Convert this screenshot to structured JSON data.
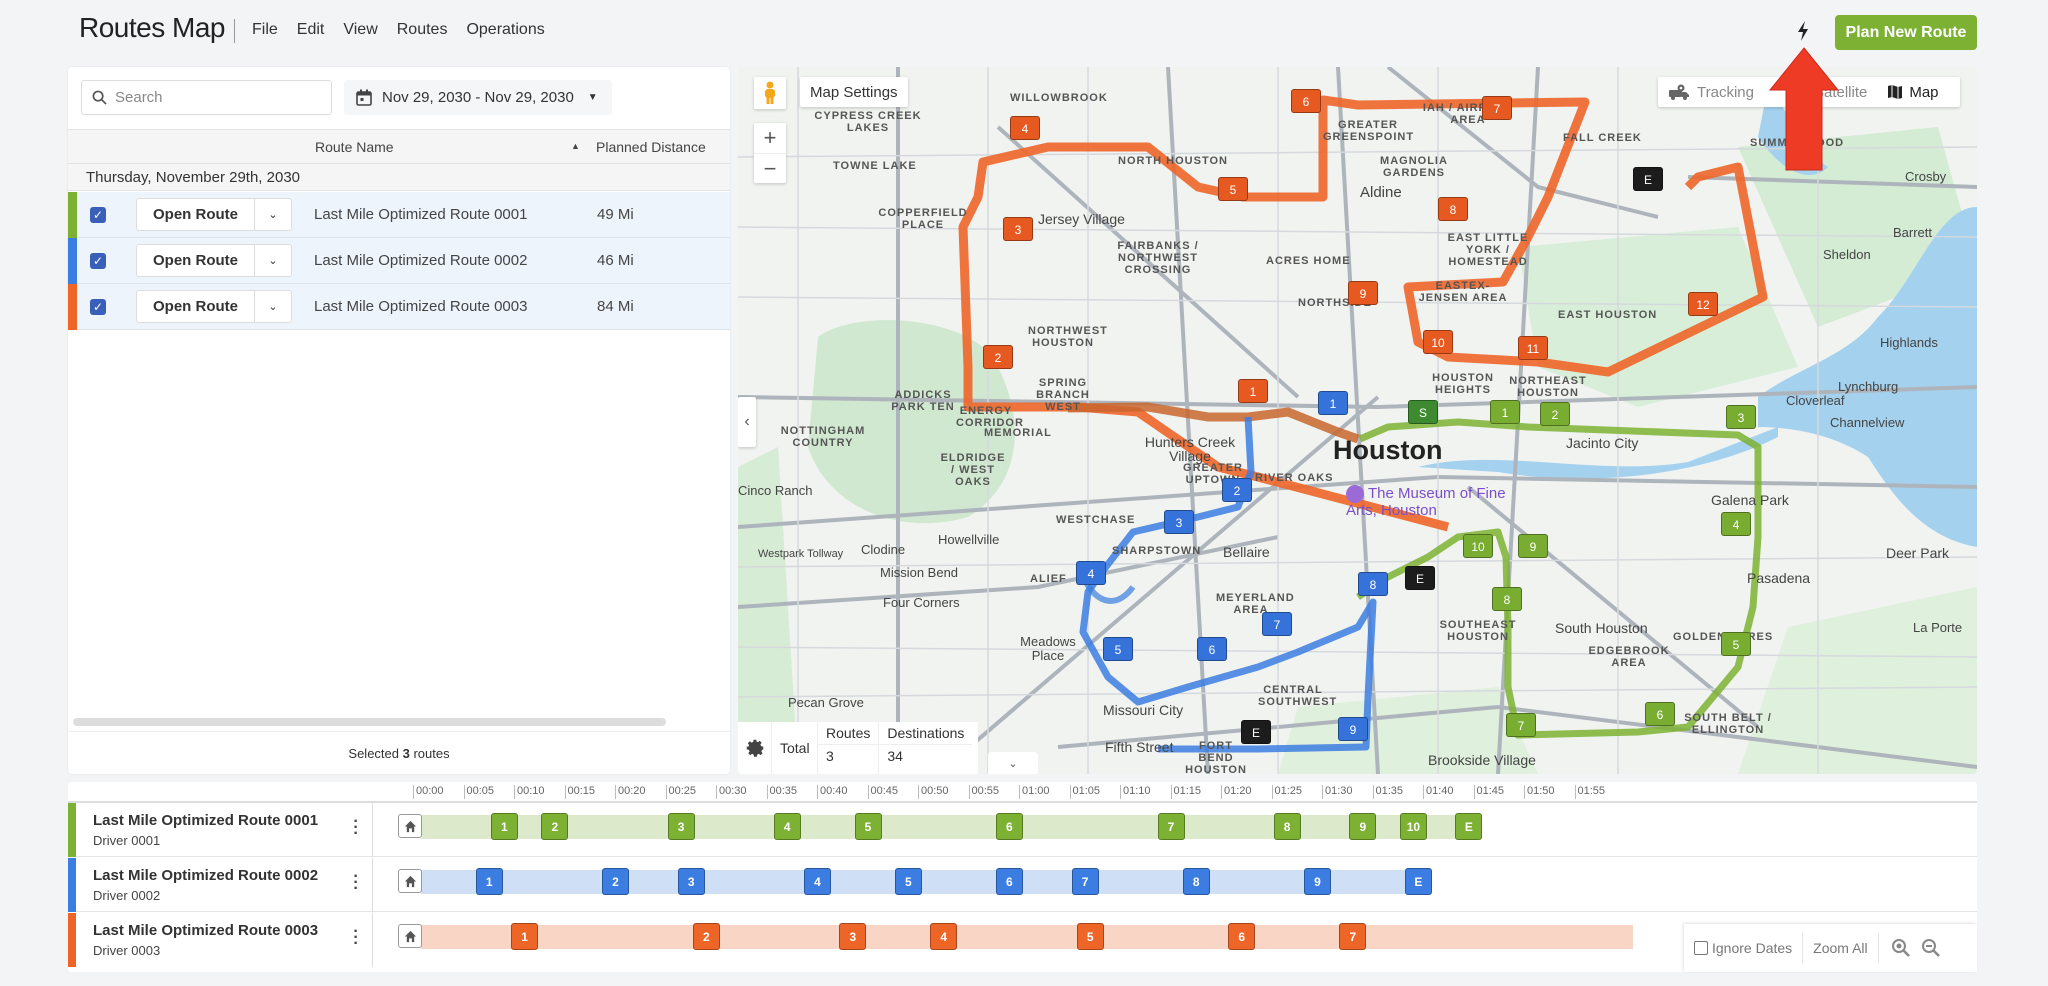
{
  "header": {
    "title": "Routes Map",
    "menu": [
      "File",
      "Edit",
      "View",
      "Routes",
      "Operations"
    ],
    "plan_new_route_label": "Plan New Route"
  },
  "left_panel": {
    "search_placeholder": "Search",
    "date_range": "Nov 29, 2030 - Nov 29, 2030",
    "columns": {
      "route_name": "Route Name",
      "planned_distance": "Planned Distance"
    },
    "group_label": "Thursday, November 29th, 2030",
    "open_route_label": "Open Route",
    "routes": [
      {
        "name": "Last Mile Optimized Route 0001",
        "distance": "49 Mi",
        "color": "#7cb133",
        "checked": true
      },
      {
        "name": "Last Mile Optimized Route 0002",
        "distance": "46 Mi",
        "color": "#3b7de0",
        "checked": true
      },
      {
        "name": "Last Mile Optimized Route 0003",
        "distance": "84 Mi",
        "color": "#ee6528",
        "checked": true
      }
    ],
    "footer": {
      "prefix": "Selected ",
      "count": "3",
      "suffix": " routes"
    }
  },
  "map": {
    "map_settings_label": "Map Settings",
    "tracking_label": "Tracking",
    "satellite_label": "Satellite",
    "map_label": "Map",
    "city_label": "Houston",
    "poi_label": "The Museum of Fine Arts, Houston",
    "totals": {
      "label": "Total",
      "routes_header": "Routes",
      "destinations_header": "Destinations",
      "routes_value": "3",
      "destinations_value": "34"
    },
    "place_labels": [
      "WILLOWBROOK",
      "CYPRESS CREEK LAKES",
      "TOWNE LAKE",
      "NORTH HOUSTON",
      "GREATER GREENSPOINT",
      "IAH / AIRPORT AREA",
      "FALL CREEK",
      "SUMMERWOOD",
      "MAGNOLIA GARDENS",
      "Aldine",
      "Jersey Village",
      "COPPERFIELD PLACE",
      "ACRES HOME",
      "EAST LITTLE YORK / HOMESTEAD",
      "FAIRBANKS / NORTHWEST CROSSING",
      "NORTHSIDE",
      "EASTEX-JENSEN AREA",
      "Sheldon",
      "Barrett",
      "Crosby",
      "EAST HOUSTON",
      "Highlands",
      "NORTHWEST HOUSTON",
      "SPRING BRANCH WEST",
      "ADDICKS PARK TEN",
      "ENERGY CORRIDOR",
      "NOTTINGHAM COUNTRY",
      "MEMORIAL",
      "HOUSTON HEIGHTS",
      "NORTHEAST HOUSTON",
      "Lynchburg",
      "Cloverleaf",
      "Channelview",
      "ELDRIDGE / WEST OAKS",
      "Hunters Creek Village",
      "GREATER UPTOWN",
      "RIVER OAKS",
      "Jacinto City",
      "Cinco Ranch",
      "Galena Park",
      "WESTCHASE",
      "Howellville",
      "Westpark Tollway",
      "Clodine",
      "SHARPSTOWN",
      "Bellaire",
      "Deer Park",
      "Mission Bend",
      "ALIEF",
      "Pasadena",
      "Four Corners",
      "MEYERLAND AREA",
      "SOUTHEAST HOUSTON",
      "South Houston",
      "Meadows Place",
      "GOLDEN ACRES",
      "La Porte",
      "EDGEBROOK AREA",
      "CENTRAL SOUTHWEST",
      "Missouri City",
      "SOUTH BELT / ELLINGTON",
      "Fifth Street",
      "FORT BEND HOUSTON",
      "Brookside Village",
      "Pecan Grove"
    ],
    "markers": {
      "route_0001": [
        "S",
        "1",
        "2",
        "3",
        "4",
        "5",
        "6",
        "7",
        "8",
        "9",
        "10",
        "E"
      ],
      "route_0002": [
        "1",
        "2",
        "3",
        "4",
        "5",
        "6",
        "7",
        "8",
        "9",
        "E"
      ],
      "route_0003": [
        "1",
        "2",
        "3",
        "4",
        "5",
        "6",
        "7",
        "8",
        "9",
        "10",
        "11",
        "12",
        "E"
      ]
    }
  },
  "timeline": {
    "ticks": [
      "00:00",
      "00:05",
      "00:10",
      "00:15",
      "00:20",
      "00:25",
      "00:30",
      "00:35",
      "00:40",
      "00:45",
      "00:50",
      "00:55",
      "01:00",
      "01:05",
      "01:10",
      "01:15",
      "01:20",
      "01:25",
      "01:30",
      "01:35",
      "01:40",
      "01:45",
      "01:50",
      "01:55"
    ],
    "rows": [
      {
        "route": "Last Mile Optimized Route 0001",
        "driver": "Driver 0001",
        "color": "#7cb133",
        "strip": "#dde9cb",
        "end_min": 105,
        "stops": [
          {
            "label": "1",
            "min": 9
          },
          {
            "label": "2",
            "min": 14
          },
          {
            "label": "3",
            "min": 26.5
          },
          {
            "label": "4",
            "min": 37
          },
          {
            "label": "5",
            "min": 45
          },
          {
            "label": "6",
            "min": 59
          },
          {
            "label": "7",
            "min": 75
          },
          {
            "label": "8",
            "min": 86.5
          },
          {
            "label": "9",
            "min": 94
          },
          {
            "label": "10",
            "min": 99
          },
          {
            "label": "E",
            "min": 104.5
          }
        ]
      },
      {
        "route": "Last Mile Optimized Route 0002",
        "driver": "Driver 0002",
        "color": "#3b7de0",
        "strip": "#cfdff6",
        "end_min": 99.5,
        "stops": [
          {
            "label": "1",
            "min": 7.5
          },
          {
            "label": "2",
            "min": 20
          },
          {
            "label": "3",
            "min": 27.5
          },
          {
            "label": "4",
            "min": 40
          },
          {
            "label": "5",
            "min": 49
          },
          {
            "label": "6",
            "min": 59
          },
          {
            "label": "7",
            "min": 66.5
          },
          {
            "label": "8",
            "min": 77.5
          },
          {
            "label": "9",
            "min": 89.5
          },
          {
            "label": "E",
            "min": 99.5
          }
        ]
      },
      {
        "route": "Last Mile Optimized Route 0003",
        "driver": "Driver 0003",
        "color": "#ee6528",
        "strip": "#f9d5c6",
        "end_min": 120,
        "stops": [
          {
            "label": "1",
            "min": 11
          },
          {
            "label": "2",
            "min": 29
          },
          {
            "label": "3",
            "min": 43.5
          },
          {
            "label": "4",
            "min": 52.5
          },
          {
            "label": "5",
            "min": 67
          },
          {
            "label": "6",
            "min": 82
          },
          {
            "label": "7",
            "min": 93
          }
        ]
      }
    ],
    "ignore_dates_label": "Ignore Dates",
    "ignore_dates_checked": false,
    "zoom_all_label": "Zoom All"
  }
}
